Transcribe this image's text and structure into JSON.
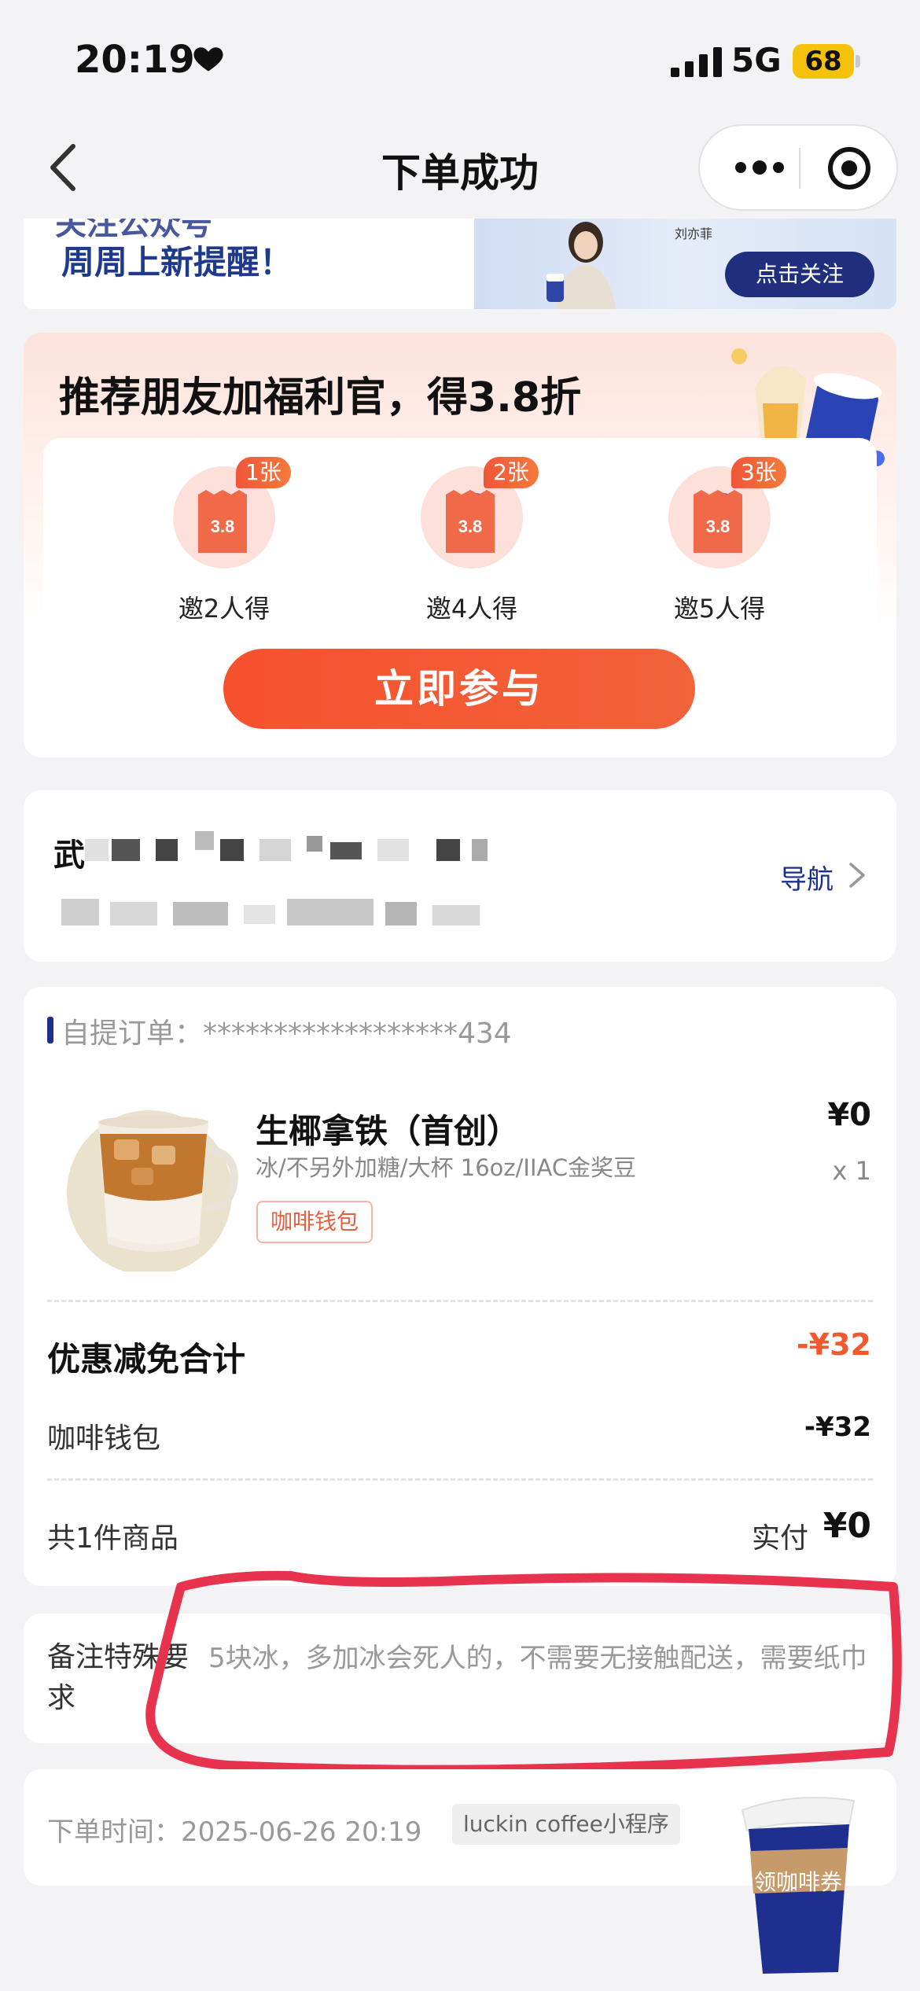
{
  "status_bar": {
    "time": "20:19",
    "network": "5G",
    "battery": "68"
  },
  "nav": {
    "title": "下单成功"
  },
  "follow_banner": {
    "cut_text": "关注公众号",
    "text": "周周上新提醒！",
    "signature": "刘亦菲",
    "button": "点击关注"
  },
  "referral": {
    "title": "推荐朋友加福利官，得3.8折",
    "ticket_value": "3.8",
    "tiers": [
      {
        "badge": "1张",
        "label": "邀2人得"
      },
      {
        "badge": "2张",
        "label": "邀4人得"
      },
      {
        "badge": "3张",
        "label": "邀5人得"
      }
    ],
    "join_button": "立即参与"
  },
  "store": {
    "name_visible": "武",
    "nav_label": "导航"
  },
  "order": {
    "pickup_label": "自提订单：******************434",
    "product": {
      "name": "生椰拿铁（首创）",
      "spec": "冰/不另外加糖/大杯 16oz/IIAC金奖豆",
      "tag": "咖啡钱包",
      "price": "¥0",
      "qty": "x 1"
    },
    "discount_title": "优惠减免合计",
    "discount_total": "-¥32",
    "wallet_label": "咖啡钱包",
    "wallet_value": "-¥32",
    "count_label": "共1件商品",
    "paid_label": "实付",
    "paid_value": "¥0"
  },
  "remark": {
    "label": "备注特殊要求",
    "text": "5块冰，多加冰会死人的，不需要无接触配送，需要纸巾"
  },
  "order_time": {
    "text": "下单时间：2025-06-26 20:19",
    "source": "luckin coffee小程序"
  },
  "coupon_float": {
    "text": "领咖啡券"
  },
  "colors": {
    "brand_blue": "#1d2f8a",
    "accent_orange": "#f2592f",
    "annotation_red": "#e8334f"
  }
}
